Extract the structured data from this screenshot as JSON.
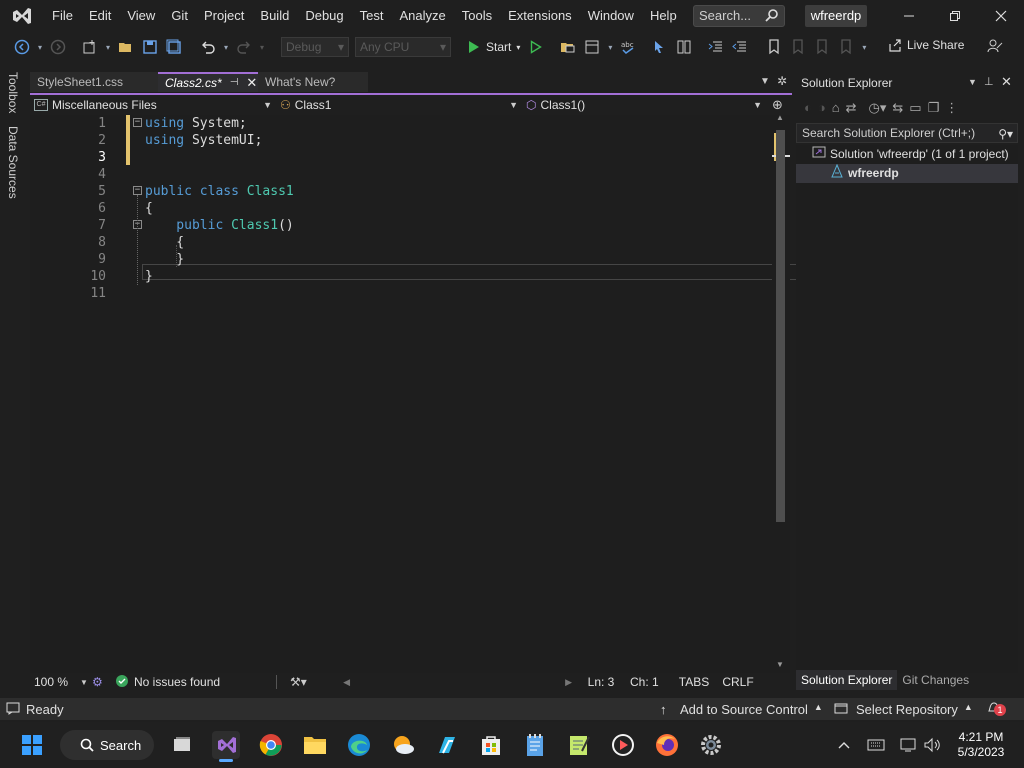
{
  "menu": {
    "items": [
      "File",
      "Edit",
      "View",
      "Git",
      "Project",
      "Build",
      "Debug",
      "Test",
      "Analyze",
      "Tools",
      "Extensions",
      "Window",
      "Help"
    ],
    "search_placeholder": "Search...",
    "solution_badge": "wfreerdp"
  },
  "toolbar": {
    "config": "Debug",
    "platform": "Any CPU",
    "start_label": "Start",
    "live_share": "Live Share"
  },
  "left_strip": {
    "toolbox": "Toolbox",
    "data_sources": "Data Sources"
  },
  "tabs": [
    {
      "label": "StyleSheet1.css"
    },
    {
      "label": "Class2.cs*"
    },
    {
      "label": "What's New?"
    }
  ],
  "navbar": {
    "project": "Miscellaneous Files",
    "type": "Class1",
    "member": "Class1()"
  },
  "editor": {
    "line_numbers": [
      "1",
      "2",
      "3",
      "4",
      "5",
      "6",
      "7",
      "8",
      "9",
      "10",
      "11"
    ],
    "current_line": 3,
    "lines": [
      [
        {
          "t": "using",
          "c": "kw"
        },
        {
          "t": " System;",
          "c": "id"
        }
      ],
      [
        {
          "t": "using",
          "c": "kw"
        },
        {
          "t": " SystemUI;",
          "c": "id"
        }
      ],
      [],
      [],
      [
        {
          "t": "public",
          "c": "kw"
        },
        {
          "t": " ",
          "c": "id"
        },
        {
          "t": "class",
          "c": "kw"
        },
        {
          "t": " ",
          "c": "id"
        },
        {
          "t": "Class1",
          "c": "cls"
        }
      ],
      [
        {
          "t": "{",
          "c": "id"
        }
      ],
      [
        {
          "t": "    public",
          "c": "kw"
        },
        {
          "t": " ",
          "c": "id"
        },
        {
          "t": "Class1",
          "c": "cls"
        },
        {
          "t": "()",
          "c": "id"
        }
      ],
      [
        {
          "t": "    {",
          "c": "id"
        }
      ],
      [
        {
          "t": "    }",
          "c": "id"
        }
      ],
      [
        {
          "t": "}",
          "c": "id"
        }
      ],
      []
    ]
  },
  "editor_status": {
    "zoom": "100 %",
    "issues": "No issues found",
    "line": "Ln: 3",
    "col": "Ch: 1",
    "tabs": "TABS",
    "eol": "CRLF"
  },
  "solution_explorer": {
    "title": "Solution Explorer",
    "search_placeholder": "Search Solution Explorer (Ctrl+;)",
    "solution_label": "Solution 'wfreerdp' (1 of 1 project)",
    "project_label": "wfreerdp",
    "tabs": [
      "Solution Explorer",
      "Git Changes"
    ]
  },
  "statusbar": {
    "ready": "Ready",
    "source_control": "Add to Source Control",
    "repository": "Select Repository",
    "notifications": "1"
  },
  "taskbar": {
    "search": "Search",
    "time": "4:21 PM",
    "date": "5/3/2023"
  },
  "colors": {
    "accent": "#a26fd6",
    "keyword": "#569cd6",
    "class": "#4ec9b0"
  }
}
